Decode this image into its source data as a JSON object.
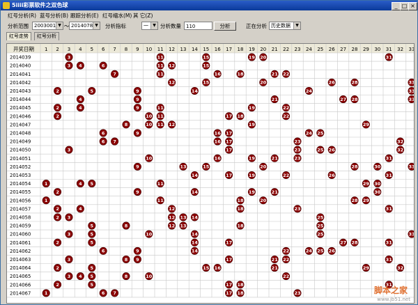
{
  "window": {
    "title": "5iiii彩票软件之双色球",
    "minimize": "_",
    "maximize": "□",
    "close": "×"
  },
  "menu": [
    "红号分析(R)",
    "蓝号分析(B)",
    "跟踪分析(E)",
    "红号缩水(M)",
    "其  它(Z)"
  ],
  "toolbar": {
    "range_label": "分析范围",
    "range_from": "2003001",
    "range_sep": "～",
    "range_to": "2014078",
    "metric_label": "分析指标",
    "metric_value": "一",
    "count_label": "分析数量",
    "count_value": "110",
    "analyze_button": "分析",
    "status_label": "正在分析",
    "status_value": "历史数据"
  },
  "tabs": [
    "红号走势",
    "红号分析"
  ],
  "grid": {
    "header_label": "开奖日期",
    "columns": [
      "1",
      "2",
      "3",
      "4",
      "5",
      "6",
      "7",
      "8",
      "9",
      "10",
      "11",
      "12",
      "13",
      "14",
      "15",
      "16",
      "17",
      "18",
      "19",
      "20",
      "21",
      "22",
      "23",
      "24",
      "25",
      "26",
      "27",
      "28",
      "29",
      "30",
      "31",
      "32",
      "33"
    ],
    "rows": [
      {
        "date": "2014039",
        "balls": [
          3,
          11,
          15,
          19,
          20,
          31
        ]
      },
      {
        "date": "2014040",
        "balls": [
          3,
          4,
          6,
          11,
          12,
          15
        ]
      },
      {
        "date": "2014041",
        "balls": [
          7,
          11,
          16,
          18,
          21,
          22
        ]
      },
      {
        "date": "2014042",
        "balls": [
          12,
          15,
          20,
          26,
          28,
          33
        ]
      },
      {
        "date": "2014043",
        "balls": [
          2,
          5,
          9,
          14,
          24,
          33
        ]
      },
      {
        "date": "2014044",
        "balls": [
          4,
          9,
          21,
          27,
          28,
          33
        ]
      },
      {
        "date": "2014045",
        "balls": [
          2,
          4,
          9,
          11,
          19,
          22
        ]
      },
      {
        "date": "2014046",
        "balls": [
          2,
          10,
          11,
          17,
          18,
          22
        ]
      },
      {
        "date": "2014047",
        "balls": [
          8,
          10,
          11,
          12,
          19,
          29
        ]
      },
      {
        "date": "2014048",
        "balls": [
          6,
          9,
          16,
          17,
          24,
          25
        ]
      },
      {
        "date": "2014049",
        "balls": [
          6,
          7,
          16,
          17,
          23,
          32
        ]
      },
      {
        "date": "2014050",
        "balls": [
          3,
          17,
          23,
          25,
          26,
          32
        ]
      },
      {
        "date": "2014051",
        "balls": [
          10,
          16,
          19,
          21,
          23,
          31
        ]
      },
      {
        "date": "2014052",
        "balls": [
          9,
          13,
          15,
          20,
          28,
          30,
          33
        ]
      },
      {
        "date": "2014053",
        "balls": [
          14,
          17,
          19,
          22,
          26,
          31
        ]
      },
      {
        "date": "2014054",
        "balls": [
          1,
          4,
          5,
          11,
          29,
          30
        ]
      },
      {
        "date": "2014055",
        "balls": [
          2,
          9,
          14,
          19,
          21,
          30
        ]
      },
      {
        "date": "2014056",
        "balls": [
          1,
          11,
          18,
          20,
          28,
          29
        ]
      },
      {
        "date": "2014057",
        "balls": [
          2,
          4,
          12,
          18,
          23,
          31
        ]
      },
      {
        "date": "2014058",
        "balls": [
          2,
          3,
          12,
          13,
          14,
          25
        ]
      },
      {
        "date": "2014059",
        "balls": [
          5,
          8,
          12,
          13,
          18,
          25
        ]
      },
      {
        "date": "2014060",
        "balls": [
          3,
          5,
          10,
          14,
          25,
          33
        ]
      },
      {
        "date": "2014061",
        "balls": [
          2,
          5,
          14,
          17,
          27,
          28,
          31
        ]
      },
      {
        "date": "2014062",
        "balls": [
          6,
          9,
          14,
          22,
          24,
          25,
          26
        ]
      },
      {
        "date": "2014063",
        "balls": [
          3,
          8,
          9,
          17,
          21,
          22,
          31
        ]
      },
      {
        "date": "2014064",
        "balls": [
          2,
          5,
          15,
          16,
          21,
          29,
          32
        ]
      },
      {
        "date": "2014065",
        "balls": [
          3,
          4,
          5,
          8,
          10,
          22
        ]
      },
      {
        "date": "2014066",
        "balls": [
          2,
          5,
          17,
          18,
          31
        ]
      },
      {
        "date": "2014067",
        "balls": [
          1,
          6,
          7,
          17,
          18,
          23
        ]
      }
    ]
  },
  "watermark": {
    "text": "脚本之家",
    "sub": "www.jb51.net"
  },
  "colors": {
    "ball": "#8b0000",
    "ball_text": "#ffffff",
    "grid_line": "#c8c8c8",
    "header_bg": "#ece9d8"
  }
}
